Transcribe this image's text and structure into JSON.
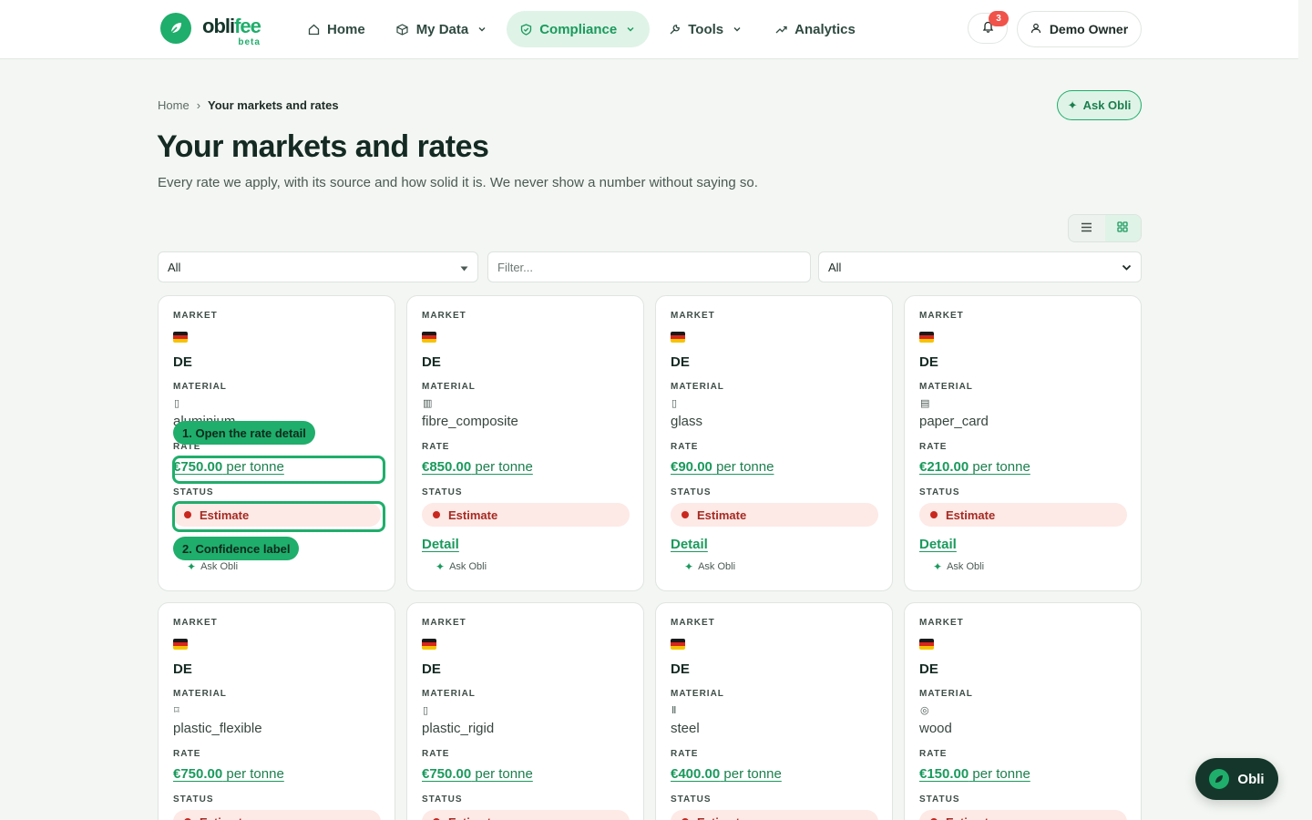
{
  "app": {
    "logo_word_a": "obli",
    "logo_word_b": "fee",
    "logo_beta": "beta",
    "brand_color": "#1fae6b"
  },
  "nav": {
    "items": [
      {
        "label": "Home",
        "icon": "home-icon"
      },
      {
        "label": "My Data",
        "icon": "box-icon"
      },
      {
        "label": "Compliance",
        "icon": "shield-icon",
        "active": true
      },
      {
        "label": "Tools",
        "icon": "wrench-icon"
      },
      {
        "label": "Analytics",
        "icon": "trend-icon"
      }
    ],
    "notifications_count": "3",
    "user_label": "Demo Owner"
  },
  "header": {
    "breadcrumb_home": "Home",
    "breadcrumb_sep": "›",
    "breadcrumb_current": "Your markets and rates",
    "ask_label": "Ask Obli",
    "title": "Your markets and rates",
    "subtitle": "Every rate we apply, with its source and how solid it is. We never show a number without saying so."
  },
  "filters": {
    "market_value": "All",
    "filter_placeholder": "Filter...",
    "status_value": "All"
  },
  "labels": {
    "market": "MARKET",
    "material": "MATERIAL",
    "rate": "RATE",
    "status": "STATUS",
    "detail": "Detail",
    "ask": "Ask Obli"
  },
  "cards": [
    {
      "market": "DE",
      "material": "aluminium",
      "mat_icon": "▯",
      "amount": "€750.00",
      "unit": "per tonne",
      "status": "Estimate"
    },
    {
      "market": "DE",
      "material": "fibre_composite",
      "mat_icon": "▥",
      "amount": "€850.00",
      "unit": "per tonne",
      "status": "Estimate"
    },
    {
      "market": "DE",
      "material": "glass",
      "mat_icon": "▯",
      "amount": "€90.00",
      "unit": "per tonne",
      "status": "Estimate"
    },
    {
      "market": "DE",
      "material": "paper_card",
      "mat_icon": "▤",
      "amount": "€210.00",
      "unit": "per tonne",
      "status": "Estimate"
    },
    {
      "market": "DE",
      "material": "plastic_flexible",
      "mat_icon": "⌑",
      "amount": "€750.00",
      "unit": "per tonne",
      "status": "Estimate"
    },
    {
      "market": "DE",
      "material": "plastic_rigid",
      "mat_icon": "▯",
      "amount": "€750.00",
      "unit": "per tonne",
      "status": "Estimate"
    },
    {
      "market": "DE",
      "material": "steel",
      "mat_icon": "Ⅱ",
      "amount": "€400.00",
      "unit": "per tonne",
      "status": "Estimate"
    },
    {
      "market": "DE",
      "material": "wood",
      "mat_icon": "◎",
      "amount": "€150.00",
      "unit": "per tonne",
      "status": "Estimate"
    }
  ],
  "tutorial": {
    "step1": "1. Open the rate detail",
    "step2": "2. Confidence label"
  },
  "fab": {
    "label": "Obli"
  }
}
